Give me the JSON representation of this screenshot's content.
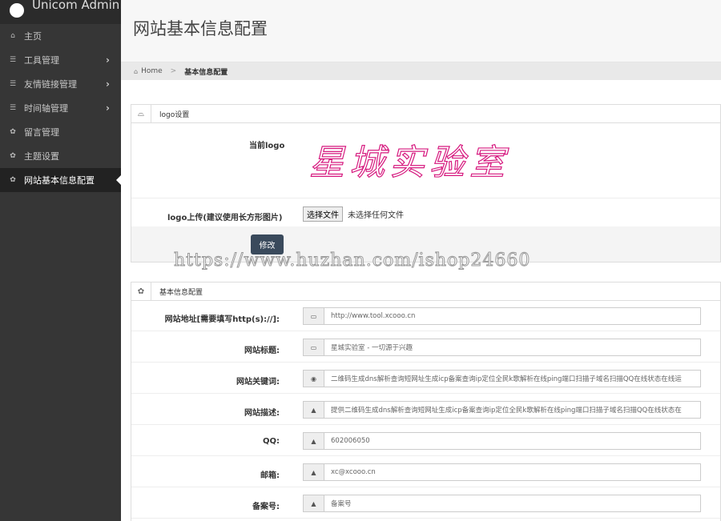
{
  "brand": {
    "name": "Unicom Admin"
  },
  "sidebar": {
    "items": [
      {
        "label": "主页",
        "icon": "home-icon",
        "glyph": "⌂",
        "has_children": false
      },
      {
        "label": "工具管理",
        "icon": "list-icon",
        "glyph": "☰",
        "has_children": true
      },
      {
        "label": "友情链接管理",
        "icon": "list-icon",
        "glyph": "☰",
        "has_children": true
      },
      {
        "label": "时间轴管理",
        "icon": "list-icon",
        "glyph": "☰",
        "has_children": true
      },
      {
        "label": "留言管理",
        "icon": "gear-icon",
        "glyph": "✿",
        "has_children": false
      },
      {
        "label": "主题设置",
        "icon": "gear-icon",
        "glyph": "✿",
        "has_children": false
      },
      {
        "label": "网站基本信息配置",
        "icon": "gear-icon",
        "glyph": "✿",
        "has_children": false,
        "active": true
      }
    ],
    "chevron": "›"
  },
  "page": {
    "title": "网站基本信息配置",
    "breadcrumb": {
      "home": "Home",
      "separator": ">",
      "current": "基本信息配置"
    }
  },
  "logo_panel": {
    "title": "logo设置",
    "current_logo_label": "当前logo",
    "logo_text": "星城实验室",
    "upload_label": "logo上传(建议使用长方形图片)",
    "file_button": "选择文件",
    "file_status": "未选择任何文件",
    "submit_label": "修改"
  },
  "watermark": "https://www.huzhan.com/ishop24660",
  "info_panel": {
    "title": "基本信息配置",
    "fields": [
      {
        "label": "网站地址[需要填写http(s)://]:",
        "icon": "card-icon",
        "glyph": "▭",
        "value": "http://www.tool.xcooo.cn"
      },
      {
        "label": "网站标题:",
        "icon": "card-icon",
        "glyph": "▭",
        "value": "星城实验室 - 一切源于兴趣"
      },
      {
        "label": "网站关键词:",
        "icon": "eye-icon",
        "glyph": "◉",
        "value": "二维码生成dns解析查询短网址生成icp备案查询ip定位全民k歌解析在线ping端口扫描子域名扫描QQ在线状态在线运"
      },
      {
        "label": "网站描述:",
        "icon": "image-icon",
        "glyph": "▲",
        "value": "提供二维码生成dns解析查询短网址生成icp备案查询ip定位全民k歌解析在线ping端口扫描子域名扫描QQ在线状态在"
      },
      {
        "label": "QQ:",
        "icon": "image-icon",
        "glyph": "▲",
        "value": "602006050"
      },
      {
        "label": "邮箱:",
        "icon": "image-icon",
        "glyph": "▲",
        "value": "xc@xcooo.cn"
      },
      {
        "label": "备案号:",
        "icon": "image-icon",
        "glyph": "▲",
        "value": "备案号"
      }
    ]
  },
  "colors": {
    "sidebar_bg": "#363636",
    "sidebar_active": "#222222",
    "logo_outline": "#d6187e",
    "submit_button": "#3a4a5c"
  }
}
